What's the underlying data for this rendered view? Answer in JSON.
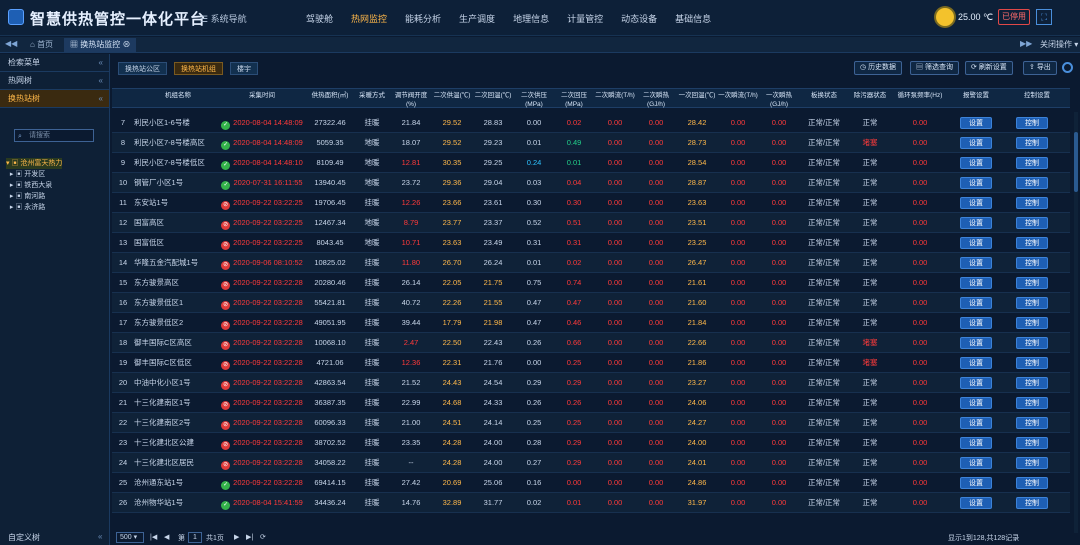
{
  "header": {
    "app_title": "智慧供热管控一体化平台",
    "nav_toggle": "系统导航",
    "nav": [
      "驾驶舱",
      "热网监控",
      "能耗分析",
      "生产调度",
      "地理信息",
      "计量管控",
      "动态设备",
      "基础信息"
    ],
    "active_nav": "热网监控",
    "temperature": "25.00 ℃",
    "logout": "已停用",
    "fullscreen_icon": "expand-icon",
    "accent": "#ffb84a"
  },
  "tabs": {
    "home": "首页",
    "current": "换热站监控",
    "close_ops": "关闭操作"
  },
  "sidebar": {
    "search_menu": "检索菜单",
    "heat_net": "热网树",
    "station_tree": "换热站树",
    "search_placeholder": "请搜索",
    "tree_root": "沧州富天热力",
    "tree_items": [
      "开发区",
      "铁西大泉",
      "南河路",
      "永济路"
    ],
    "custom_tree": "自定义树"
  },
  "toolbar": {
    "subtabs": [
      "换热站公区",
      "换热站机组",
      "楼宇"
    ],
    "active_subtab": "换热站机组",
    "buttons": [
      "历史数据",
      "筛选查询",
      "刷新设置",
      "导出"
    ]
  },
  "table": {
    "headers": [
      "机组名称",
      "采集时间",
      "供热面积(㎡)",
      "采暖方式",
      "调节阀开度(%)",
      "二次供温(℃)",
      "二次回温(℃)",
      "二次供压(MPa)",
      "二次回压(MPa)",
      "二次瞬流(T/h)",
      "二次瞬热(GJ/h)",
      "一次回温(℃)",
      "一次瞬流(T/h)",
      "一次瞬热(GJ/h)",
      "板换状态",
      "除污器状态",
      "循环泵频率(Hz)",
      "报警设置",
      "控制设置"
    ],
    "rows": [
      [
        "7",
        "利民小区1-6号楼",
        "ok",
        "2020-08-04 14:48:09",
        "27322.46",
        "挂暖",
        "21.84",
        "29.52",
        "28.83",
        "0.00",
        "0.02",
        "0.00",
        "0.00",
        "28.42",
        "0.00",
        "0.00",
        "正常/正常",
        "正常",
        "0.00"
      ],
      [
        "8",
        "利民小区7-8号楼高区",
        "ok",
        "2020-08-04 14:48:09",
        "5059.35",
        "地暖",
        "18.07",
        "29.52",
        "29.23",
        "0.01",
        "0.49",
        "0.00",
        "0.00",
        "28.73",
        "0.00",
        "0.00",
        "正常/正常",
        "堵塞",
        "0.00"
      ],
      [
        "9",
        "利民小区7-8号楼低区",
        "ok",
        "2020-08-04 14:48:10",
        "8109.49",
        "地暖",
        "12.81",
        "30.35",
        "29.25",
        "0.24",
        "0.01",
        "0.00",
        "0.00",
        "28.54",
        "0.00",
        "0.00",
        "正常/正常",
        "正常",
        "0.00"
      ],
      [
        "10",
        "钢管厂小区1号",
        "ok",
        "2020-07-31 16:11:55",
        "13940.45",
        "地暖",
        "23.72",
        "29.36",
        "29.04",
        "0.03",
        "0.04",
        "0.00",
        "0.00",
        "28.87",
        "0.00",
        "0.00",
        "正常/正常",
        "正常",
        "0.00"
      ],
      [
        "11",
        "东安站1号",
        "bad",
        "2020-09-22 03:22:25",
        "19706.45",
        "挂暖",
        "12.26",
        "23.66",
        "23.61",
        "0.30",
        "0.30",
        "0.00",
        "0.00",
        "23.63",
        "0.00",
        "0.00",
        "正常/正常",
        "正常",
        "0.00"
      ],
      [
        "12",
        "国富高区",
        "bad",
        "2020-09-22 03:22:25",
        "12467.34",
        "地暖",
        "8.79",
        "23.77",
        "23.37",
        "0.52",
        "0.51",
        "0.00",
        "0.00",
        "23.51",
        "0.00",
        "0.00",
        "正常/正常",
        "正常",
        "0.00"
      ],
      [
        "13",
        "国富低区",
        "bad",
        "2020-09-22 03:22:25",
        "8043.45",
        "地暖",
        "10.71",
        "23.63",
        "23.49",
        "0.31",
        "0.31",
        "0.00",
        "0.00",
        "23.25",
        "0.00",
        "0.00",
        "正常/正常",
        "正常",
        "0.00"
      ],
      [
        "14",
        "华隆五金汽配城1号",
        "bad",
        "2020-09-06 08:10:52",
        "10825.02",
        "挂暖",
        "11.80",
        "26.70",
        "26.24",
        "0.01",
        "0.02",
        "0.00",
        "0.00",
        "26.47",
        "0.00",
        "0.00",
        "正常/正常",
        "正常",
        "0.00"
      ],
      [
        "15",
        "东方骏景高区",
        "bad",
        "2020-09-22 03:22:28",
        "20280.46",
        "挂暖",
        "26.14",
        "22.05",
        "21.75",
        "0.75",
        "0.74",
        "0.00",
        "0.00",
        "21.61",
        "0.00",
        "0.00",
        "正常/正常",
        "正常",
        "0.00"
      ],
      [
        "16",
        "东方骏景低区1",
        "bad",
        "2020-09-22 03:22:28",
        "55421.81",
        "挂暖",
        "40.72",
        "22.26",
        "21.55",
        "0.47",
        "0.47",
        "0.00",
        "0.00",
        "21.60",
        "0.00",
        "0.00",
        "正常/正常",
        "正常",
        "0.00"
      ],
      [
        "17",
        "东方骏景低区2",
        "bad",
        "2020-09-22 03:22:28",
        "49051.95",
        "挂暖",
        "39.44",
        "17.79",
        "21.98",
        "0.47",
        "0.46",
        "0.00",
        "0.00",
        "21.84",
        "0.00",
        "0.00",
        "正常/正常",
        "正常",
        "0.00"
      ],
      [
        "18",
        "御丰国际C区高区",
        "bad",
        "2020-09-22 03:22:28",
        "10068.10",
        "挂暖",
        "2.47",
        "22.50",
        "22.43",
        "0.26",
        "0.66",
        "0.00",
        "0.00",
        "22.66",
        "0.00",
        "0.00",
        "正常/正常",
        "堵塞",
        "0.00"
      ],
      [
        "19",
        "御丰国际C区低区",
        "bad",
        "2020-09-22 03:22:28",
        "4721.06",
        "挂暖",
        "12.36",
        "22.31",
        "21.76",
        "0.00",
        "0.25",
        "0.00",
        "0.00",
        "21.86",
        "0.00",
        "0.00",
        "正常/正常",
        "堵塞",
        "0.00"
      ],
      [
        "20",
        "中油中化小区1号",
        "bad",
        "2020-09-22 03:22:28",
        "42863.54",
        "挂暖",
        "21.52",
        "24.43",
        "24.54",
        "0.29",
        "0.29",
        "0.00",
        "0.00",
        "23.27",
        "0.00",
        "0.00",
        "正常/正常",
        "正常",
        "0.00"
      ],
      [
        "21",
        "十三化建南区1号",
        "bad",
        "2020-09-22 03:22:28",
        "36387.35",
        "挂暖",
        "22.99",
        "24.68",
        "24.33",
        "0.26",
        "0.26",
        "0.00",
        "0.00",
        "24.06",
        "0.00",
        "0.00",
        "正常/正常",
        "正常",
        "0.00"
      ],
      [
        "22",
        "十三化建南区2号",
        "bad",
        "2020-09-22 03:22:28",
        "60096.33",
        "挂暖",
        "21.00",
        "24.51",
        "24.14",
        "0.25",
        "0.25",
        "0.00",
        "0.00",
        "24.27",
        "0.00",
        "0.00",
        "正常/正常",
        "正常",
        "0.00"
      ],
      [
        "23",
        "十三化建北区公建",
        "bad",
        "2020-09-22 03:22:28",
        "38702.52",
        "挂暖",
        "23.35",
        "24.28",
        "24.00",
        "0.28",
        "0.29",
        "0.00",
        "0.00",
        "24.00",
        "0.00",
        "0.00",
        "正常/正常",
        "正常",
        "0.00"
      ],
      [
        "24",
        "十三化建北区居民",
        "bad",
        "2020-09-22 03:22:28",
        "34058.22",
        "挂暖",
        "--",
        "24.28",
        "24.00",
        "0.27",
        "0.29",
        "0.00",
        "0.00",
        "24.01",
        "0.00",
        "0.00",
        "正常/正常",
        "正常",
        "0.00"
      ],
      [
        "25",
        "沧州通东站1号",
        "ok",
        "2020-09-22 03:22:28",
        "69414.15",
        "挂暖",
        "27.42",
        "20.69",
        "25.06",
        "0.16",
        "0.00",
        "0.00",
        "0.00",
        "24.86",
        "0.00",
        "0.00",
        "正常/正常",
        "正常",
        "0.00"
      ],
      [
        "26",
        "沧州物华站1号",
        "ok",
        "2020-08-04 15:41:59",
        "34436.24",
        "挂暖",
        "14.76",
        "32.89",
        "31.77",
        "0.02",
        "0.01",
        "0.00",
        "0.00",
        "31.97",
        "0.00",
        "0.00",
        "正常/正常",
        "正常",
        "0.00"
      ]
    ],
    "alarm_label": "设置",
    "control_label": "控制"
  },
  "footer": {
    "page_size": "500",
    "page_prefix": "第",
    "page": "1",
    "page_suffix": "共1页",
    "summary": "显示1到128,共128记录"
  }
}
